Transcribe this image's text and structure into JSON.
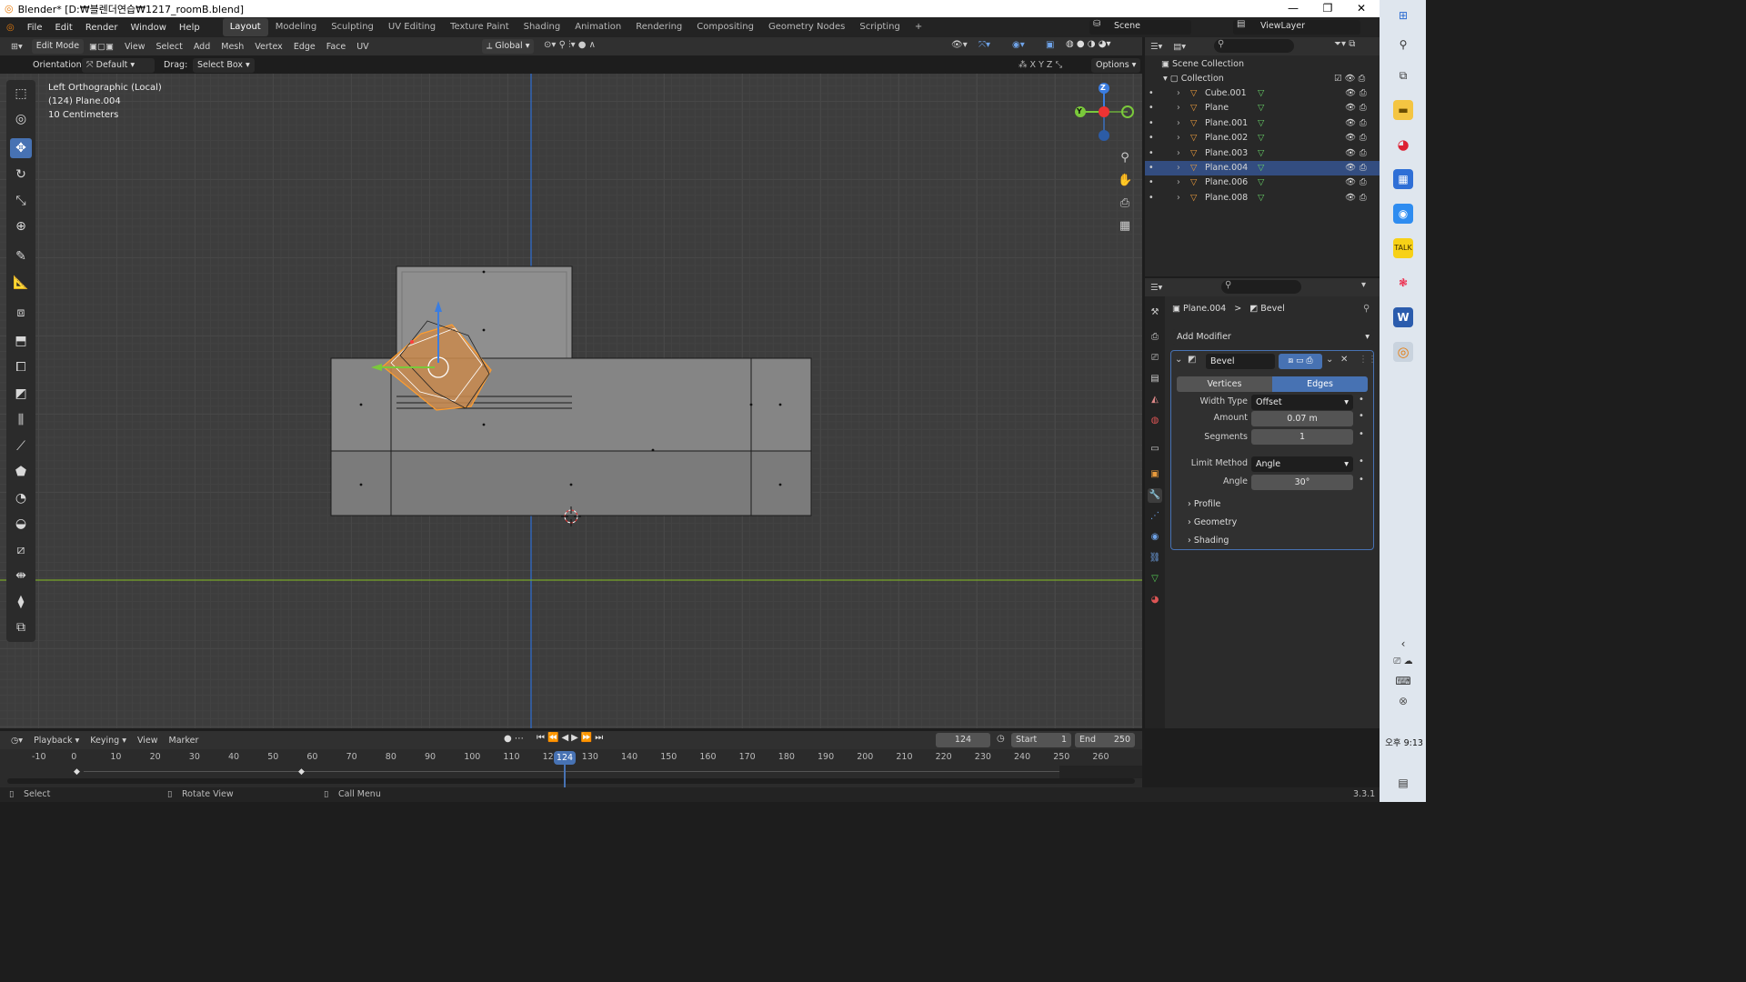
{
  "window": {
    "title": "Blender* [D:₩블렌더연습₩1217_roomB.blend]",
    "min": "—",
    "max": "❐",
    "close": "✕"
  },
  "menu": {
    "items": [
      "File",
      "Edit",
      "Render",
      "Window",
      "Help"
    ],
    "workspaces": [
      "Layout",
      "Modeling",
      "Sculpting",
      "UV Editing",
      "Texture Paint",
      "Shading",
      "Animation",
      "Rendering",
      "Compositing",
      "Geometry Nodes",
      "Scripting"
    ],
    "add_tab": "+",
    "scene": "Scene",
    "view_layer": "ViewLayer"
  },
  "header3d": {
    "mode": "Edit Mode",
    "view": "View",
    "select": "Select",
    "add": "Add",
    "mesh": "Mesh",
    "vertex": "Vertex",
    "edge": "Edge",
    "face": "Face",
    "uv": "UV",
    "transform": "Global"
  },
  "toolsettings": {
    "orientation_label": "Orientation:",
    "orientation_value": "Default",
    "drag_label": "Drag:",
    "drag_value": "Select Box",
    "x": "X",
    "y": "Y",
    "z": "Z",
    "options": "Options"
  },
  "viewport": {
    "view_name": "Left Orthographic (Local)",
    "object": "(124) Plane.004",
    "scale": "10 Centimeters"
  },
  "gizmo": {
    "z": "Z",
    "y": "Y"
  },
  "outliner": {
    "root": "Scene Collection",
    "collection": "Collection",
    "items": [
      {
        "name": "Cube.001",
        "selected": false
      },
      {
        "name": "Plane",
        "selected": false
      },
      {
        "name": "Plane.001",
        "selected": false
      },
      {
        "name": "Plane.002",
        "selected": false
      },
      {
        "name": "Plane.003",
        "selected": false
      },
      {
        "name": "Plane.004",
        "selected": true
      },
      {
        "name": "Plane.006",
        "selected": false
      },
      {
        "name": "Plane.008",
        "selected": false
      }
    ]
  },
  "properties": {
    "breadcrumb_object": "Plane.004",
    "breadcrumb_sep": ">",
    "breadcrumb_modifier": "Bevel",
    "add_modifier": "Add Modifier",
    "modifier_name": "Bevel",
    "tab_vertices": "Vertices",
    "tab_edges": "Edges",
    "width_type_label": "Width Type",
    "width_type_value": "Offset",
    "amount_label": "Amount",
    "amount_value": "0.07 m",
    "segments_label": "Segments",
    "segments_value": "1",
    "limit_label": "Limit Method",
    "limit_value": "Angle",
    "angle_label": "Angle",
    "angle_value": "30°",
    "panels": [
      "Profile",
      "Geometry",
      "Shading"
    ]
  },
  "timeline": {
    "playback": "Playback",
    "keying": "Keying",
    "view": "View",
    "marker": "Marker",
    "current_frame": "124",
    "start_label": "Start",
    "start": "1",
    "end_label": "End",
    "end": "250",
    "ticks": [
      "-10",
      "0",
      "10",
      "20",
      "30",
      "40",
      "50",
      "60",
      "70",
      "80",
      "90",
      "100",
      "110",
      "120",
      "130",
      "140",
      "150",
      "160",
      "170",
      "180",
      "190",
      "200",
      "210",
      "220",
      "230",
      "240",
      "250",
      "260"
    ],
    "playhead": "124"
  },
  "status": {
    "select": "Select",
    "rotate": "Rotate View",
    "call_menu": "Call Menu",
    "version": "3.3.1"
  },
  "taskbar": {
    "time_period": "오후",
    "time": "9:13"
  }
}
